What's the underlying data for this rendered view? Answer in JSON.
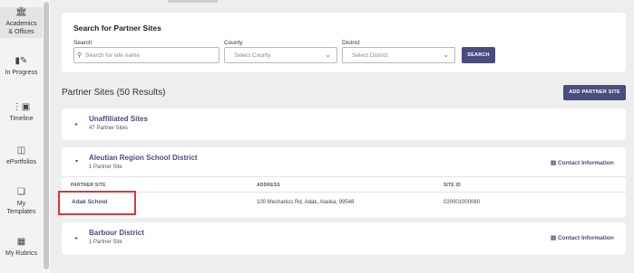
{
  "sidebar": {
    "items": [
      {
        "label": "Academics\n& Offices",
        "icon": "institution-icon"
      },
      {
        "label": "In Progress",
        "icon": "book-icon"
      },
      {
        "label": "Timeline",
        "icon": "timeline-icon"
      },
      {
        "label": "ePortfolios",
        "icon": "easel-icon"
      },
      {
        "label": "My\nTemplates",
        "icon": "template-icon"
      },
      {
        "label": "My Rubrics",
        "icon": "grid-icon"
      }
    ]
  },
  "search": {
    "title": "Search for Partner Sites",
    "search_label": "Search",
    "search_placeholder": "Search for site name",
    "county_label": "County",
    "county_value": "Select County",
    "district_label": "District",
    "district_value": "Select District",
    "search_button": "SEARCH"
  },
  "results": {
    "title": "Partner Sites (50 Results)",
    "add_button": "ADD PARTNER SITE"
  },
  "groups": [
    {
      "name": "Unaffiliated Sites",
      "count": "47 Partner Sites"
    },
    {
      "name": "Aleutian Region School District",
      "count": "1 Partner Site",
      "contact": "Contact Information"
    },
    {
      "name": "Barbour District",
      "count": "1 Partner Site",
      "contact": "Contact Information"
    }
  ],
  "table": {
    "headers": [
      "PARTNER SITE",
      "ADDRESS",
      "SITE ID"
    ],
    "rows": [
      {
        "site": "Adak School",
        "address": "100 Mechanics Rd, Adak, Alaska, 99548",
        "site_id": "020001000080"
      }
    ]
  },
  "colors": {
    "accent": "#4a4c7f",
    "highlight": "#d73a3a"
  }
}
